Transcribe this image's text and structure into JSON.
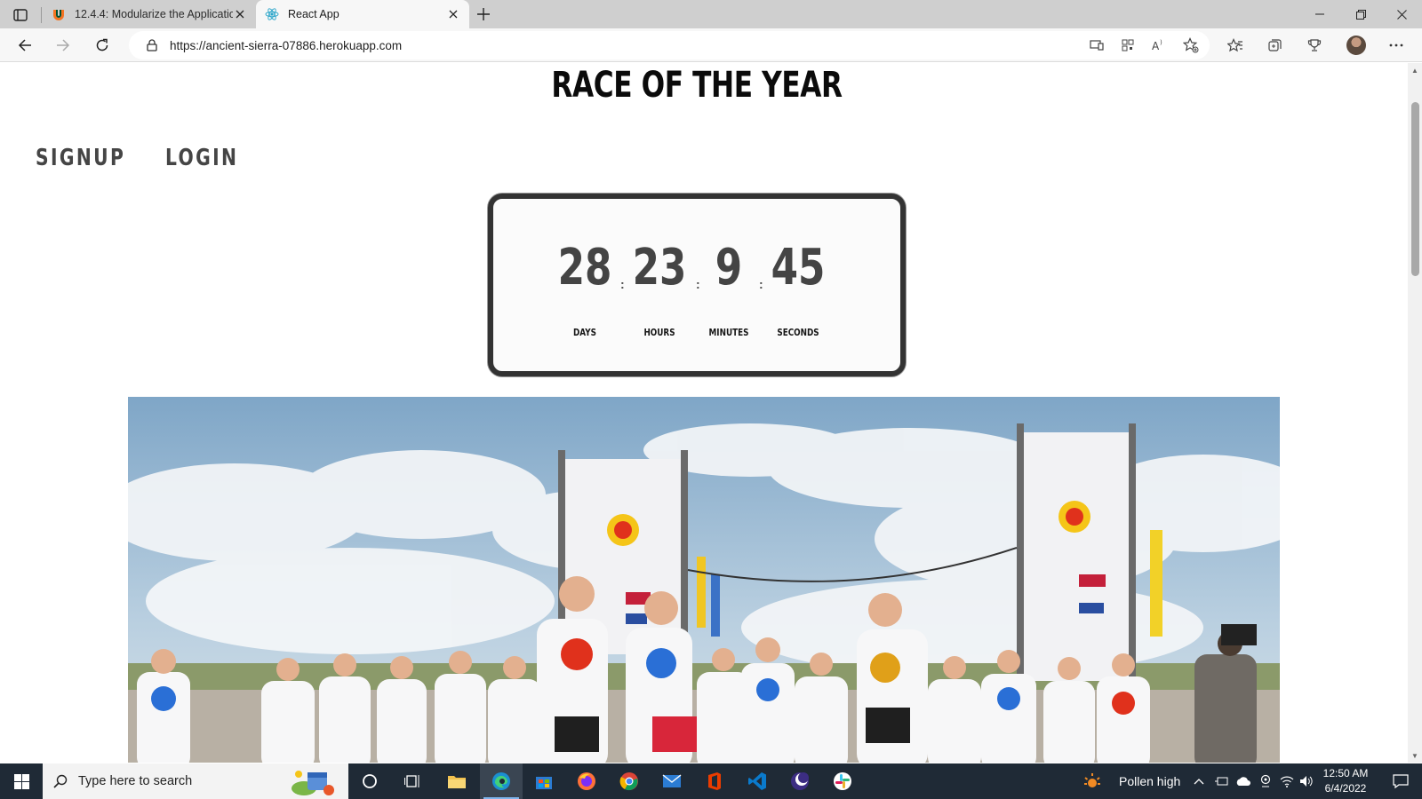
{
  "browser": {
    "tabs": [
      {
        "title": "12.4.4: Modularize the Applicatio",
        "active": false
      },
      {
        "title": "React App",
        "active": true
      }
    ],
    "url": "https://ancient-sierra-07886.herokuapp.com"
  },
  "page": {
    "title": "RACE OF THE YEAR",
    "menu": [
      {
        "label": "SIGNUP"
      },
      {
        "label": "LOGIN"
      }
    ],
    "countdown": {
      "days": "28",
      "hours": "23",
      "minutes": "9",
      "seconds": "45",
      "days_label": "DAYS",
      "hours_label": "HOURS",
      "minutes_label": "MINUTES",
      "seconds_label": "SECONDS",
      "separator": ":"
    }
  },
  "taskbar": {
    "search_placeholder": "Type here to search",
    "weather_text": "Pollen high",
    "time": "12:50 AM",
    "date": "6/4/2022"
  },
  "colors": {
    "titlebar": "#cfcfcf",
    "taskbar": "#1f2a36",
    "countdown_border": "#333333",
    "number_color": "#444444"
  }
}
